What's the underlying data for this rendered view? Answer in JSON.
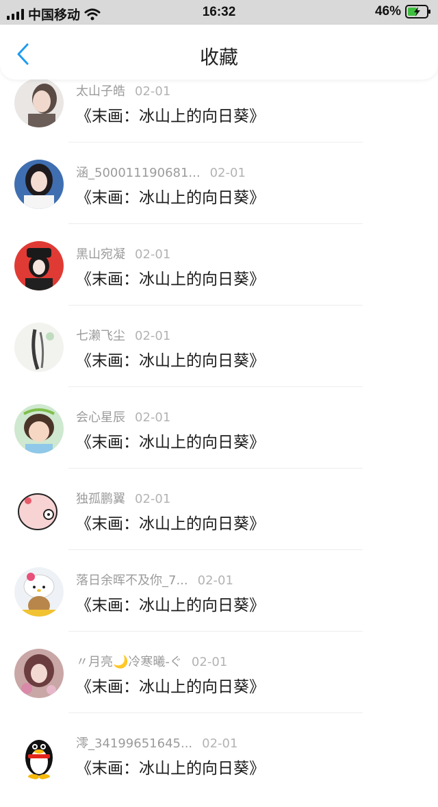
{
  "status_bar": {
    "carrier": "中国移动",
    "time": "16:32",
    "battery": "46%"
  },
  "nav": {
    "title": "收藏",
    "back_icon": "chevron-left-icon"
  },
  "colors": {
    "accent": "#1d9bf0",
    "battery_green": "#3fbf3f",
    "divider": "#ededed"
  },
  "items": [
    {
      "user": "太山子皓",
      "date": "02-01",
      "title": "《末画：冰山上的向日葵》",
      "avatar": "portrait-photo"
    },
    {
      "user": "涵_500011190681...",
      "date": "02-01",
      "title": "《末画：冰山上的向日葵》",
      "avatar": "portrait-photo"
    },
    {
      "user": "黑山宛凝",
      "date": "02-01",
      "title": "《末画：冰山上的向日葵》",
      "avatar": "anime-red-avatar"
    },
    {
      "user": "七濑飞尘",
      "date": "02-01",
      "title": "《末画：冰山上的向日葵》",
      "avatar": "ink-painting-avatar"
    },
    {
      "user": "会心星辰",
      "date": "02-01",
      "title": "《末画：冰山上的向日葵》",
      "avatar": "child-photo"
    },
    {
      "user": "独孤鹏翼",
      "date": "02-01",
      "title": "《末画：冰山上的向日葵》",
      "avatar": "pink-pig-cartoon"
    },
    {
      "user": "落日余晖不及你_7...",
      "date": "02-01",
      "title": "《末画：冰山上的向日葵》",
      "avatar": "hello-kitty-avatar"
    },
    {
      "user": "〃月亮🌙冷寒曦-ぐ",
      "date": "02-01",
      "title": "《末画：冰山上的向日葵》",
      "avatar": "illustrated-girl-avatar"
    },
    {
      "user": "澪_34199651645...",
      "date": "02-01",
      "title": "《末画：冰山上的向日葵》",
      "avatar": "qq-penguin-avatar"
    }
  ]
}
